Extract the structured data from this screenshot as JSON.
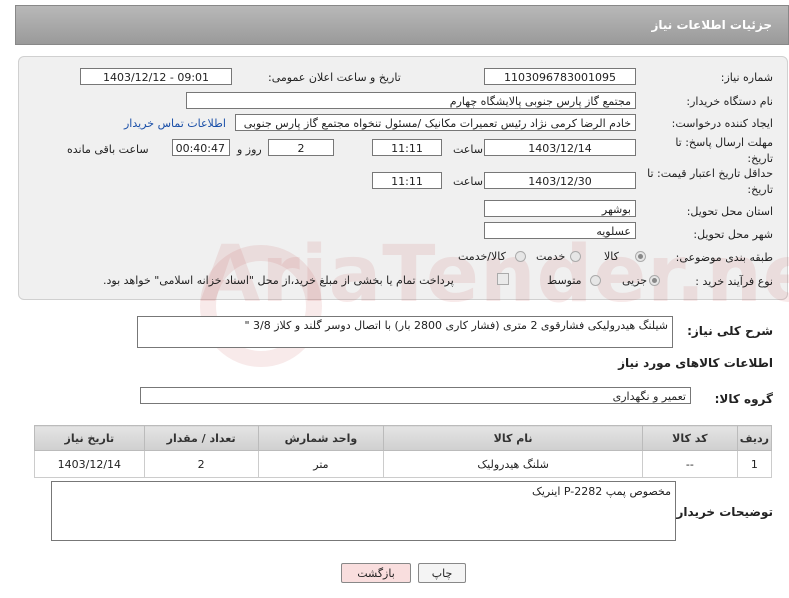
{
  "header": {
    "title": "جزئیات اطلاعات نیاز"
  },
  "form": {
    "need_number_label": "شماره نیاز:",
    "need_number": "1103096783001095",
    "announce_label": "تاریخ و ساعت اعلان عمومی:",
    "announce_value": "1403/12/12 - 09:01",
    "buyer_org_label": "نام دستگاه خریدار:",
    "buyer_org": "مجتمع گاز پارس جنوبی  پالایشگاه چهارم",
    "requester_label": "ایجاد کننده درخواست:",
    "requester": "خادم الرضا کرمی نژاد رئیس تعمیرات مکانیک /مسئول تنخواه مجتمع گاز پارس جنوبی",
    "contact_link": "اطلاعات تماس خریدار",
    "deadline_label": "مهلت ارسال پاسخ: تا تاریخ:",
    "deadline_date": "1403/12/14",
    "time_label": "ساعت",
    "deadline_time": "11:11",
    "days_value": "2",
    "days_label": "روز و",
    "remaining_time": "00:40:47",
    "remaining_label": "ساعت باقی مانده",
    "validity_label": "حداقل تاریخ اعتبار قیمت: تا تاریخ:",
    "validity_date": "1403/12/30",
    "validity_time": "11:11",
    "province_label": "استان محل تحویل:",
    "province": "بوشهر",
    "city_label": "شهر محل تحویل:",
    "city": "عسلویه",
    "category_label": "طبقه بندی موضوعی:",
    "category_options": [
      "کالا",
      "خدمت",
      "کالا/خدمت"
    ],
    "purchase_label": "نوع فرآیند خرید :",
    "purchase_options": [
      "جزیی",
      "متوسط"
    ],
    "payment_note": "پرداخت تمام یا بخشی از مبلغ خرید،از محل \"اسناد خزانه اسلامی\" خواهد بود."
  },
  "description": {
    "label": "شرح کلی نیاز:",
    "text": "شیلنگ هیدرولیکی فشارقوی 2 متری (فشار کاری 2800 بار) با اتصال دوسر گلند و کلاز 3/8 \""
  },
  "goods": {
    "section_title": "اطلاعات کالاهای مورد نیاز",
    "group_label": "گروه کالا:",
    "group_value": "تعمیر و نگهداری",
    "columns": [
      "ردیف",
      "کد کالا",
      "نام کالا",
      "واحد شمارش",
      "تعداد / مقدار",
      "تاریخ نیاز"
    ],
    "rows": [
      [
        "1",
        "--",
        "شلنگ هیدرولیک",
        "متر",
        "2",
        "1403/12/14"
      ]
    ]
  },
  "buyer_notes": {
    "label": "توضیحات خریدار:",
    "text": "مخصوص پمپ P-2282 اینریک"
  },
  "buttons": {
    "print": "چاپ",
    "back": "بازگشت"
  },
  "watermark": "AriaTender.net",
  "colors": {
    "header_bg": "#a8a8a8",
    "link": "#1a4fa8",
    "back_button_bg": "#f9dede"
  }
}
